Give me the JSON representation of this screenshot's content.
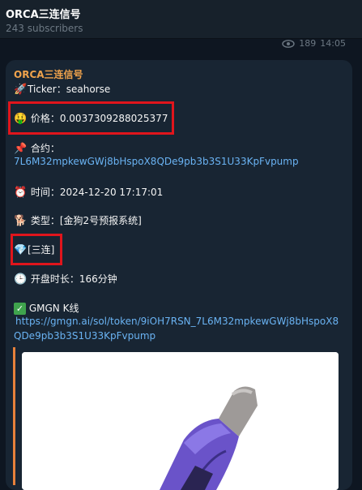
{
  "header": {
    "title": "ORCA三连信号",
    "subscribers": "243 subscribers"
  },
  "previous_meta": {
    "views": "189",
    "time": "14:05"
  },
  "message": {
    "sender": "ORCA三连信号",
    "ticker_line": "Ticker：seahorse",
    "price_label": "价格：",
    "price_value": "0.0037309288025377",
    "contract_label": "合约：",
    "contract_address": "7L6M32mpkewGWj8bHspoX8QDe9pb3b3S1U33KpFvpump",
    "time_label": "时间：",
    "time_value": "2024-12-20 17:17:01",
    "type_label": "类型：",
    "type_value": "[金狗2号预报系统]",
    "tier_tag": "[三连]",
    "duration_label": "开盘时长：",
    "duration_value": "166分钟",
    "gmgn_label": "GMGN K线",
    "gmgn_url_line1": "https://gmgn.ai/sol/token/9iOH7RSN_7L6M32mpkewGWj8bHspoX8",
    "gmgn_url_line2": "QDe9pb3b3S1U33KpFvpump"
  },
  "colors": {
    "background": "#0e1621",
    "bubble": "#182533",
    "sender": "#f0a34c",
    "link": "#6ab3f3",
    "highlight_box": "#e0151c",
    "preview_bar": "#e7813b"
  },
  "icons": [
    "eye-icon",
    "rocket-icon",
    "money-face-icon",
    "pushpin-icon",
    "alarm-clock-icon",
    "dog-icon",
    "gem-icon",
    "clock-icon",
    "check-mark-icon"
  ]
}
